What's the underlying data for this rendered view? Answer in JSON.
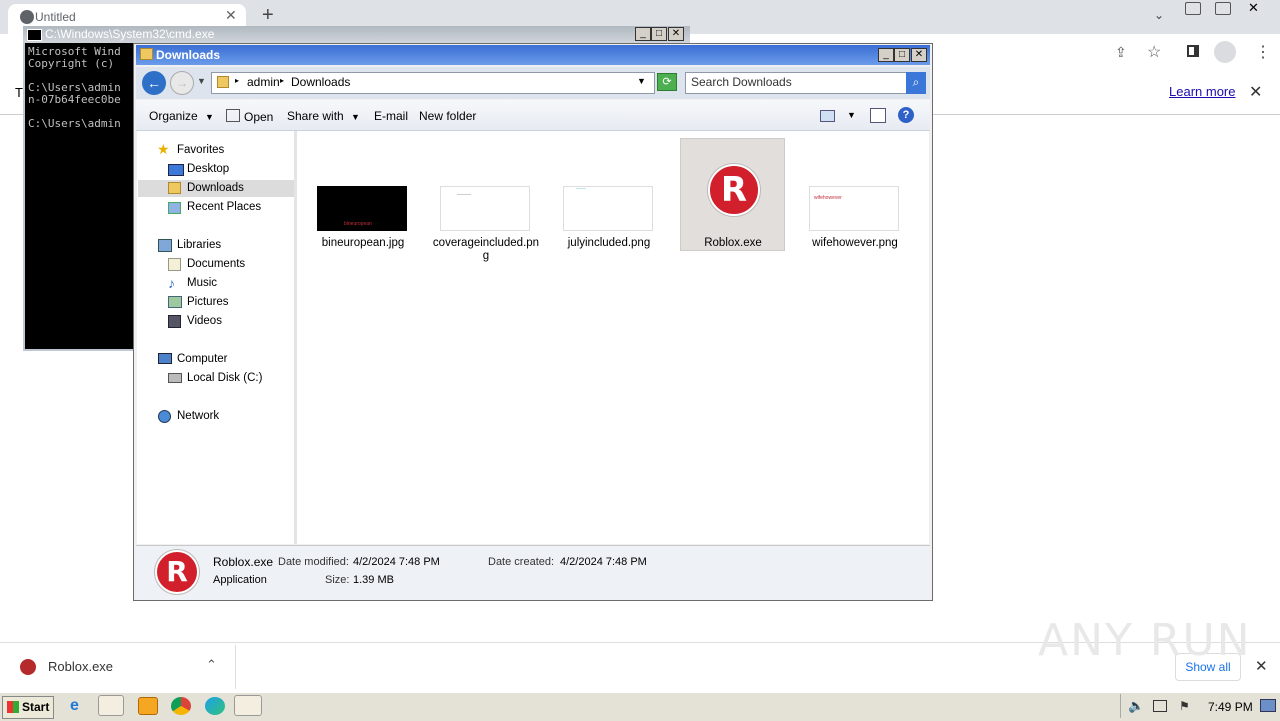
{
  "chrome": {
    "tab_title": "Untitled",
    "new_tab": "+",
    "learn_more": "Learn more",
    "left_char": "T"
  },
  "cmd": {
    "title": "C:\\Windows\\System32\\cmd.exe",
    "lines": "Microsoft Wind\nCopyright (c)\n\nC:\\Users\\admin\nn-07b64feec0be\n\nC:\\Users\\admin"
  },
  "explorer": {
    "title": "Downloads",
    "breadcrumb": [
      "admin",
      "Downloads"
    ],
    "search_placeholder": "Search Downloads",
    "toolbar": {
      "organize": "Organize",
      "open": "Open",
      "share_with": "Share with",
      "email": "E-mail",
      "new_folder": "New folder"
    },
    "nav": {
      "favorites": "Favorites",
      "desktop": "Desktop",
      "downloads": "Downloads",
      "recent": "Recent Places",
      "libraries": "Libraries",
      "documents": "Documents",
      "music": "Music",
      "pictures": "Pictures",
      "videos": "Videos",
      "computer": "Computer",
      "local_disk": "Local Disk (C:)",
      "network": "Network"
    },
    "files": [
      {
        "name": "bineuropean.jpg",
        "thumb_text": "bineuropean"
      },
      {
        "name": "coverageincluded.png",
        "thumb_text": ""
      },
      {
        "name": "julyincluded.png",
        "thumb_text": ""
      },
      {
        "name": "Roblox.exe",
        "thumb_text": ""
      },
      {
        "name": "wifehowever.png",
        "thumb_text": "wifehowever"
      }
    ],
    "details": {
      "name": "Roblox.exe",
      "modified_label": "Date modified:",
      "modified": "4/2/2024 7:48 PM",
      "created_label": "Date created:",
      "created": "4/2/2024 7:48 PM",
      "type": "Application",
      "size_label": "Size:",
      "size": "1.39 MB"
    }
  },
  "downloads_bar": {
    "item": "Roblox.exe",
    "show_all": "Show all"
  },
  "taskbar": {
    "start": "Start",
    "clock": "7:49 PM"
  },
  "watermark": "ANY RUN"
}
